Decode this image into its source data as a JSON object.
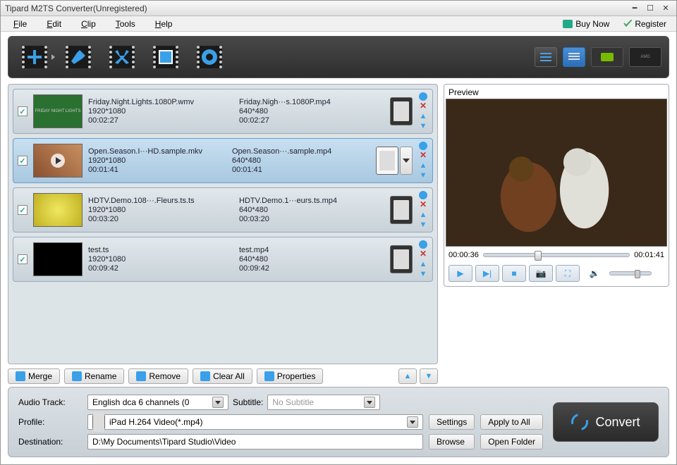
{
  "window": {
    "title": "Tipard M2TS Converter(Unregistered)"
  },
  "menu": {
    "file": "File",
    "edit": "Edit",
    "clip": "Clip",
    "tools": "Tools",
    "help": "Help",
    "buy_now": "Buy Now",
    "register": "Register"
  },
  "toolbar": {
    "amd": "AMD"
  },
  "files": [
    {
      "checked": true,
      "selected": false,
      "source": {
        "name": "Friday.Night.Lights.1080P.wmv",
        "res": "1920*1080",
        "dur": "00:02:27"
      },
      "output": {
        "name": "Friday.Nigh···s.1080P.mp4",
        "res": "640*480",
        "dur": "00:02:27"
      }
    },
    {
      "checked": true,
      "selected": true,
      "source": {
        "name": "Open.Season.I···HD.sample.mkv",
        "res": "1920*1080",
        "dur": "00:01:41"
      },
      "output": {
        "name": "Open.Season···.sample.mp4",
        "res": "640*480",
        "dur": "00:01:41"
      }
    },
    {
      "checked": true,
      "selected": false,
      "source": {
        "name": "HDTV.Demo.108···.Fleurs.ts.ts",
        "res": "1920*1080",
        "dur": "00:03:20"
      },
      "output": {
        "name": "HDTV.Demo.1···eurs.ts.mp4",
        "res": "640*480",
        "dur": "00:03:20"
      }
    },
    {
      "checked": true,
      "selected": false,
      "source": {
        "name": "test.ts",
        "res": "1920*1080",
        "dur": "00:09:42"
      },
      "output": {
        "name": "test.mp4",
        "res": "640*480",
        "dur": "00:09:42"
      }
    }
  ],
  "ops": {
    "merge": "Merge",
    "rename": "Rename",
    "remove": "Remove",
    "clear_all": "Clear All",
    "properties": "Properties"
  },
  "preview": {
    "label": "Preview",
    "current": "00:00:36",
    "total": "00:01:41"
  },
  "bottom": {
    "audio_track_label": "Audio Track:",
    "audio_track_value": "English dca 6 channels (0",
    "subtitle_label": "Subtitle:",
    "subtitle_value": "No Subtitle",
    "profile_label": "Profile:",
    "profile_value": "iPad H.264 Video(*.mp4)",
    "settings": "Settings",
    "apply_to_all": "Apply to All",
    "destination_label": "Destination:",
    "destination_value": "D:\\My Documents\\Tipard Studio\\Video",
    "browse": "Browse",
    "open_folder": "Open Folder",
    "convert": "Convert"
  }
}
